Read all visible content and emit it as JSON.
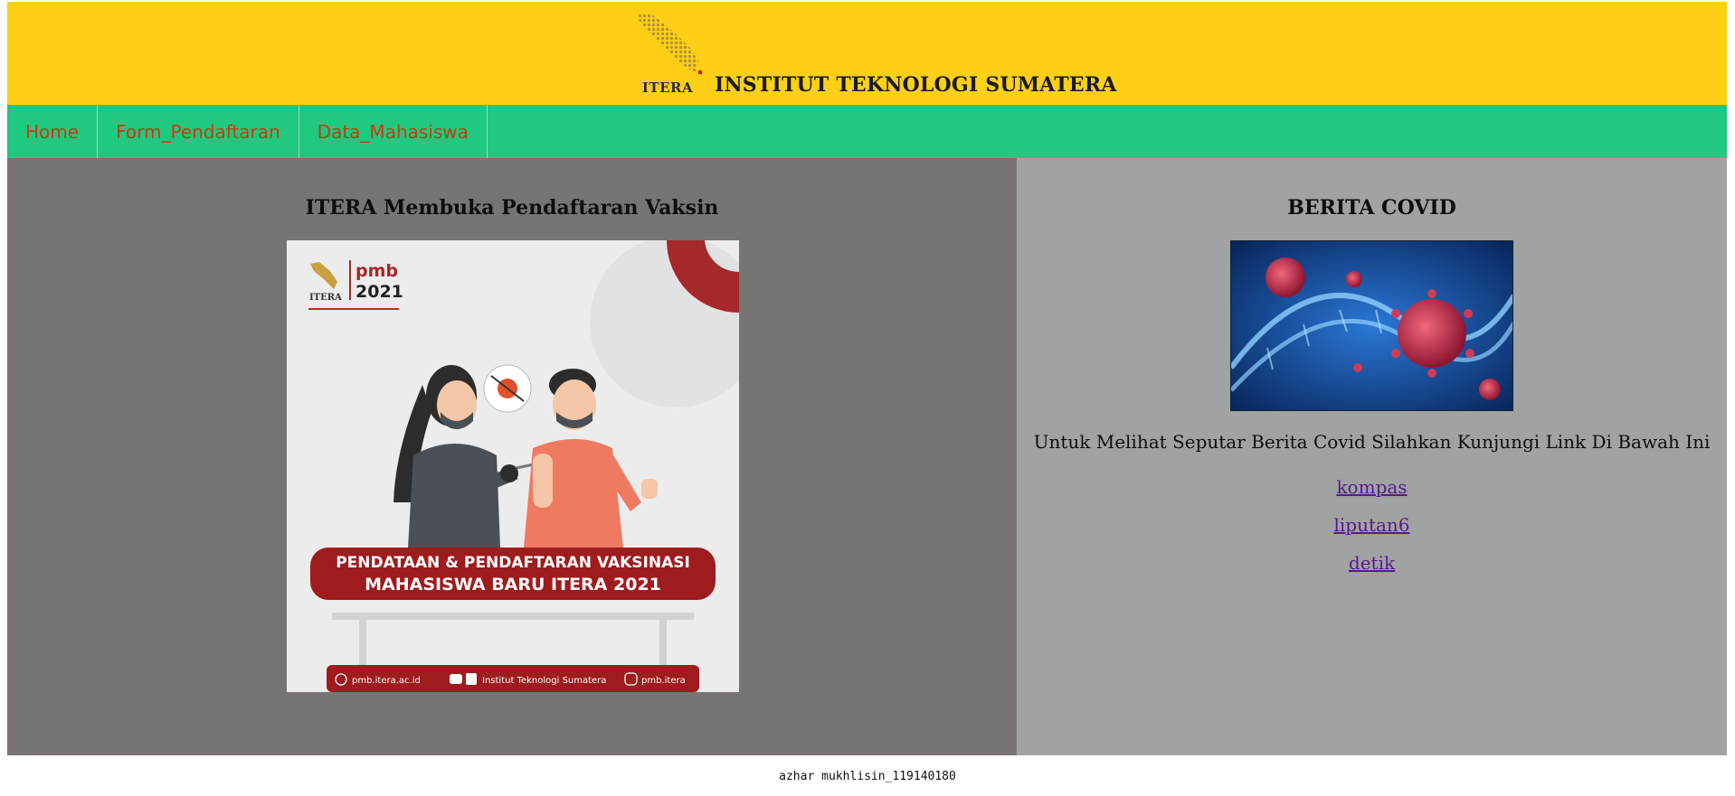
{
  "header": {
    "logo_text": "ITERA",
    "title": "INSTITUT TEKNOLOGI SUMATERA",
    "bg_color": "#fdd017"
  },
  "nav": {
    "items": [
      {
        "label": "Home"
      },
      {
        "label": "Form_Pendaftaran"
      },
      {
        "label": "Data_Mahasiswa"
      }
    ],
    "bg_color": "#20c980",
    "link_color": "#c83a10"
  },
  "main": {
    "left": {
      "title": "ITERA Membuka Pendaftaran Vaksin",
      "poster": {
        "logo_text": "ITERA",
        "pmb_label": "pmb",
        "year": "2021",
        "banner_line1": "PENDATAAN & PENDAFTARAN VAKSINASI",
        "banner_line2": "MAHASISWA BARU ITERA 2021",
        "footer_site": "pmb.itera.ac.id",
        "footer_social": "Institut Teknologi Sumatera",
        "footer_instagram": "pmb.itera"
      }
    },
    "right": {
      "title": "BERITA COVID",
      "description": "Untuk Melihat Seputar Berita Covid Silahkan Kunjungi Link Di Bawah Ini",
      "links": [
        {
          "label": "kompas"
        },
        {
          "label": "liputan6"
        },
        {
          "label": "detik"
        }
      ]
    }
  },
  "footer": {
    "text": "azhar mukhlisin_119140180"
  }
}
